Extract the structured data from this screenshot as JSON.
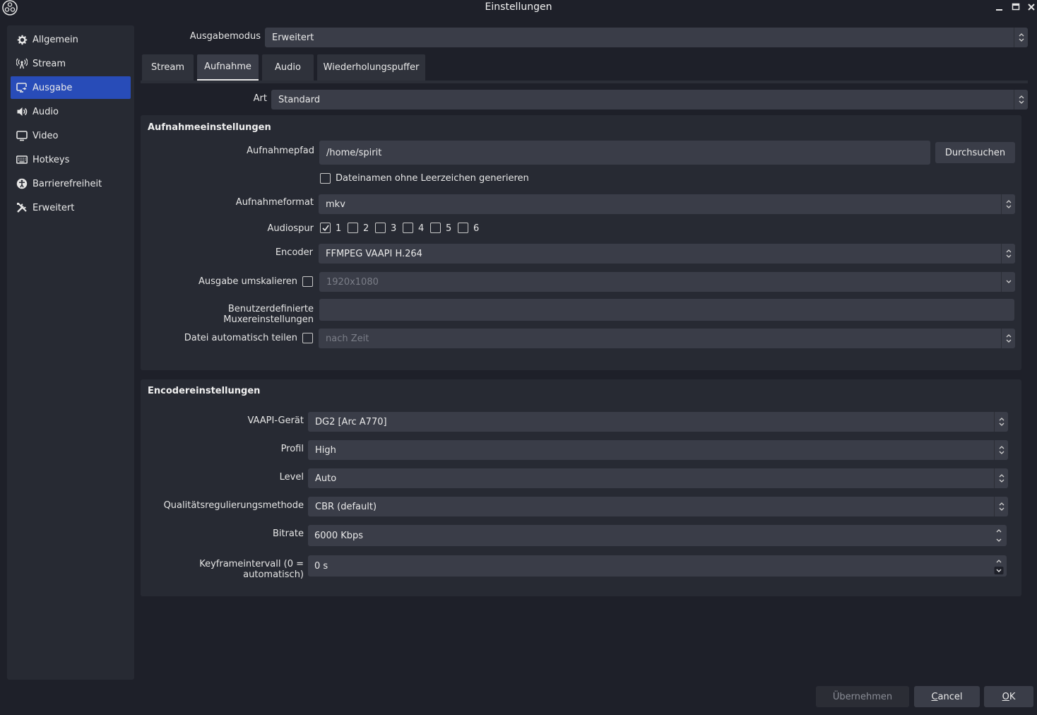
{
  "window": {
    "title": "Einstellungen"
  },
  "sidebar": {
    "items": [
      {
        "label": "Allgemein",
        "icon": "gear-icon"
      },
      {
        "label": "Stream",
        "icon": "broadcast-icon"
      },
      {
        "label": "Ausgabe",
        "icon": "output-icon",
        "active": true
      },
      {
        "label": "Audio",
        "icon": "speaker-icon"
      },
      {
        "label": "Video",
        "icon": "monitor-icon"
      },
      {
        "label": "Hotkeys",
        "icon": "keyboard-icon"
      },
      {
        "label": "Barrierefreiheit",
        "icon": "accessibility-icon"
      },
      {
        "label": "Erweitert",
        "icon": "tools-icon"
      }
    ]
  },
  "output_mode": {
    "label": "Ausgabemodus",
    "value": "Erweitert"
  },
  "tabs": [
    "Stream",
    "Aufnahme",
    "Audio",
    "Wiederholungspuffer"
  ],
  "active_tab": "Aufnahme",
  "type": {
    "label": "Art",
    "value": "Standard"
  },
  "recording": {
    "title": "Aufnahmeeinstellungen",
    "path_label": "Aufnahmepfad",
    "path_value": "/home/spirit",
    "browse_label": "Durchsuchen",
    "no_space_label": "Dateinamen ohne Leerzeichen generieren",
    "format_label": "Aufnahmeformat",
    "format_value": "mkv",
    "audiotrack_label": "Audiospur",
    "tracks": [
      {
        "num": "1",
        "checked": true
      },
      {
        "num": "2",
        "checked": false
      },
      {
        "num": "3",
        "checked": false
      },
      {
        "num": "4",
        "checked": false
      },
      {
        "num": "5",
        "checked": false
      },
      {
        "num": "6",
        "checked": false
      }
    ],
    "encoder_label": "Encoder",
    "encoder_value": "FFMPEG VAAPI H.264",
    "rescale_label": "Ausgabe umskalieren",
    "rescale_value": "1920x1080",
    "mux_label": "Benutzerdefinierte Muxereinstellungen",
    "mux_value": "",
    "split_label": "Datei automatisch teilen",
    "split_value": "nach Zeit"
  },
  "encoder": {
    "title": "Encodereinstellungen",
    "device_label": "VAAPI-Gerät",
    "device_value": "DG2 [Arc A770]",
    "profile_label": "Profil",
    "profile_value": "High",
    "level_label": "Level",
    "level_value": "Auto",
    "rc_label": "Qualitätsregulierungsmethode",
    "rc_value": "CBR (default)",
    "bitrate_label": "Bitrate",
    "bitrate_value": "6000 Kbps",
    "keyframe_label": "Keyframeintervall (0 = automatisch)",
    "keyframe_value": "0 s"
  },
  "buttons": {
    "apply": "Übernehmen",
    "cancel_first": "C",
    "cancel_rest": "ancel",
    "ok_first": "O",
    "ok_rest": "K"
  },
  "colors": {
    "accent": "#284cb8",
    "background": "#1e2029",
    "panel": "#272a33",
    "field": "#3a3d48"
  }
}
